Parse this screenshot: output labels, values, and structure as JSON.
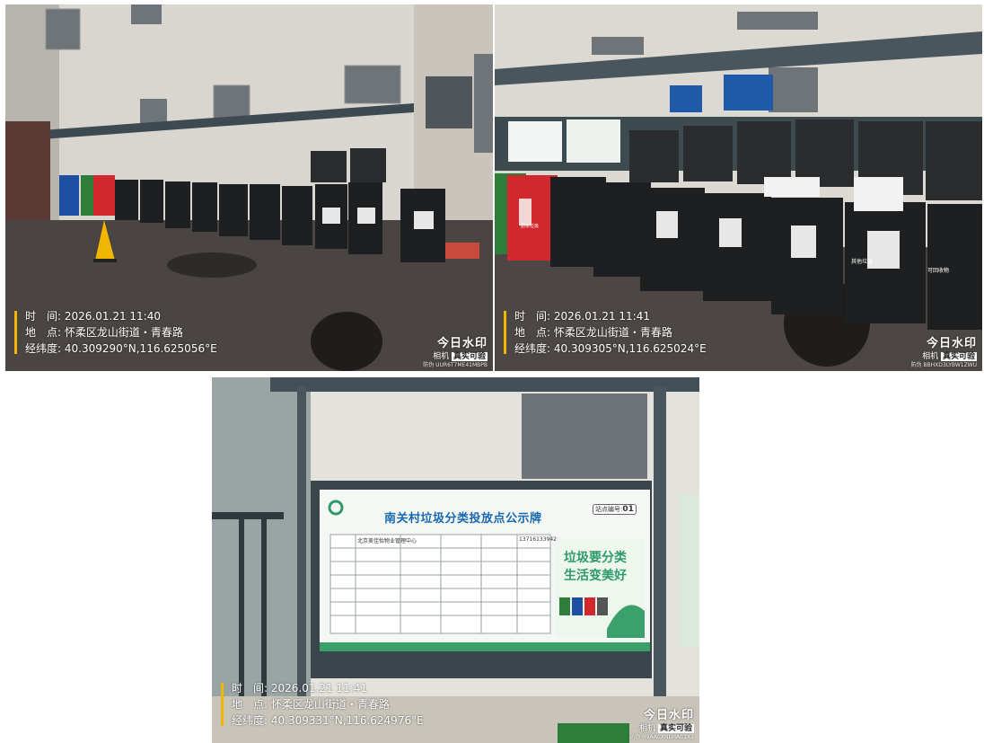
{
  "photos": [
    {
      "timestamp_label": "时　间:",
      "timestamp": "2026.01.21 11:40",
      "location_label": "地　点:",
      "location": "怀柔区龙山街道・青春路",
      "coords_label": "经纬度:",
      "coords": "40.309290°N,116.625056°E",
      "brand": "今日水印",
      "brand_sub": "相机",
      "brand_badge": "真实可验",
      "code": "防伪 UUR6T7ME41MBPB"
    },
    {
      "timestamp_label": "时　间:",
      "timestamp": "2026.01.21 11:41",
      "location_label": "地　点:",
      "location": "怀柔区龙山街道・青春路",
      "coords_label": "经纬度:",
      "coords": "40.309305°N,116.625024°E",
      "brand": "今日水印",
      "brand_sub": "相机",
      "brand_badge": "真实可验",
      "code": "防伪 BBHXD3LYBW1ZWU"
    },
    {
      "timestamp_label": "时　间:",
      "timestamp": "2026.01.21 11:41",
      "location_label": "地　点:",
      "location": "怀柔区龙山街道・青春路",
      "coords_label": "经纬度:",
      "coords": "40.309331°N,116.624976°E",
      "brand": "今日水印",
      "brand_sub": "相机",
      "brand_badge": "真实可验",
      "code": "防伪 H9AACXNLMAC1X3"
    }
  ],
  "board": {
    "title": "南关村垃圾分类投放点公示牌",
    "site_no_label": "站点编号:",
    "site_no": "01",
    "slogan_line1": "垃圾要分类",
    "slogan_line2": "生活变美好",
    "manager": "北京美佳怡物业管理中心",
    "phone": "13716133942"
  },
  "bins": {
    "other_waste": "其他垃圾",
    "recyclable": "可回收物",
    "kitchen_waste": "厨余垃圾"
  },
  "colors": {
    "watermark_bar": "#f3b600",
    "bin_black": "#1e1f21",
    "bin_red": "#d2272d",
    "bin_green": "#2e7d3a",
    "bin_blue": "#1f4fa3",
    "board_green": "#2f9a6a",
    "board_title_blue": "#1769b0"
  }
}
